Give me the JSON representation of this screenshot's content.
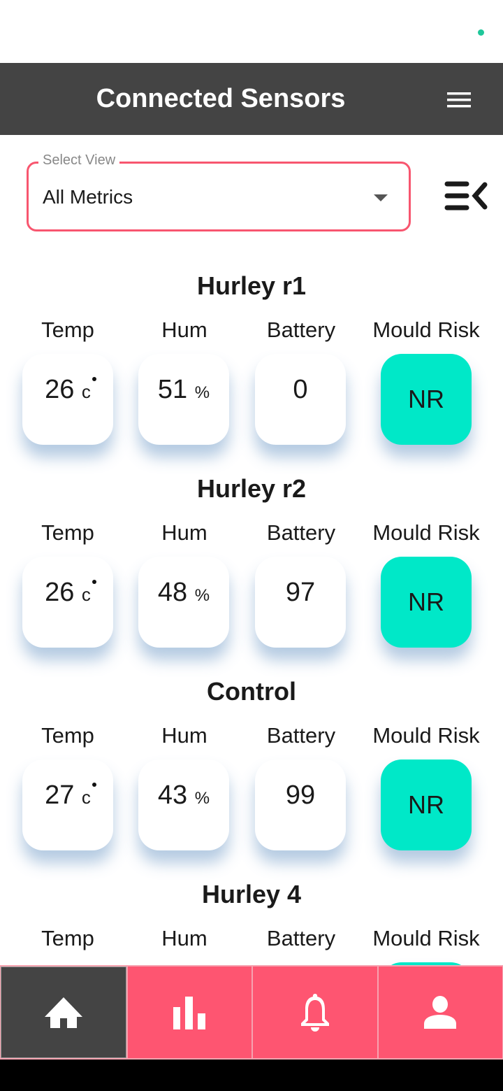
{
  "header": {
    "title": "Connected Sensors"
  },
  "select": {
    "label": "Select View",
    "value": "All Metrics"
  },
  "labels": {
    "temp": "Temp",
    "hum": "Hum",
    "battery": "Battery",
    "risk": "Mould Risk"
  },
  "units": {
    "temp": "c",
    "hum": "%"
  },
  "sensors": [
    {
      "name": "Hurley r1",
      "temp": "26",
      "hum": "51",
      "battery": "0",
      "risk": "NR"
    },
    {
      "name": "Hurley r2",
      "temp": "26",
      "hum": "48",
      "battery": "97",
      "risk": "NR"
    },
    {
      "name": "Control",
      "temp": "27",
      "hum": "43",
      "battery": "99",
      "risk": "NR"
    },
    {
      "name": "Hurley 4",
      "temp": "",
      "hum": "",
      "battery": "",
      "risk": ""
    }
  ],
  "colors": {
    "accent": "#fe5571",
    "risk_none": "#00e8c8",
    "header": "#444444",
    "status_dot": "#1fc79a"
  },
  "nav": [
    {
      "icon": "home-icon",
      "active": true
    },
    {
      "icon": "bar-chart-icon"
    },
    {
      "icon": "bell-icon"
    },
    {
      "icon": "person-icon"
    }
  ]
}
